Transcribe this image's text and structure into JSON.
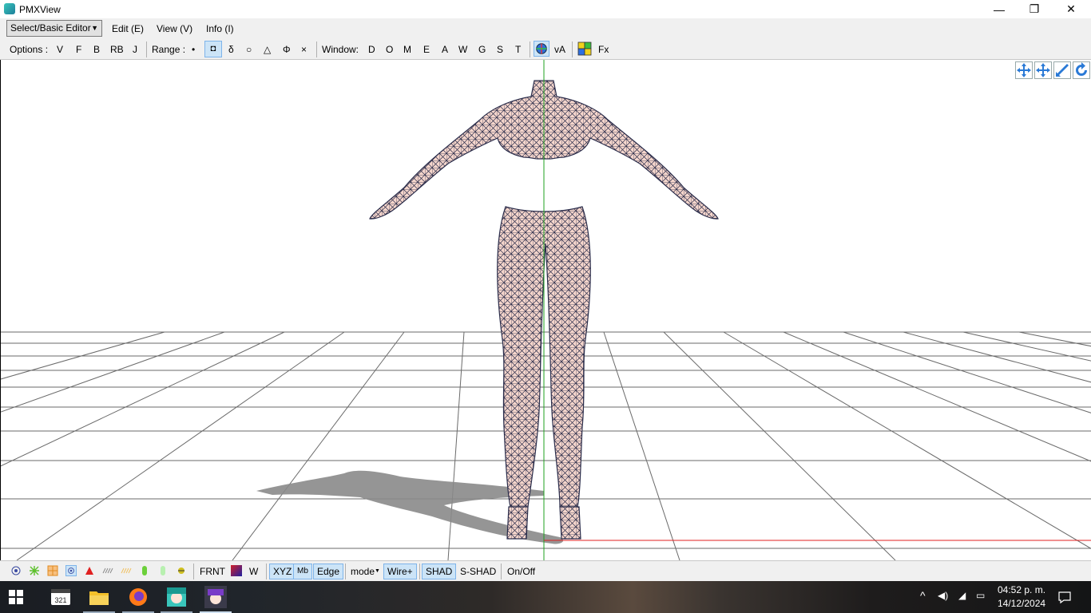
{
  "window": {
    "title": "PMXView",
    "minimize_glyph": "—",
    "maximize_glyph": "❐",
    "close_glyph": "✕"
  },
  "menubar": {
    "mode_select": "Select/Basic Editor",
    "items": [
      "Edit (E)",
      "View (V)",
      "Info (I)"
    ]
  },
  "toolbar": {
    "options_label": "Options :",
    "options": [
      "V",
      "F",
      "B",
      "RB",
      "J"
    ],
    "range_label": "Range :",
    "range_items": [
      "•",
      "◘",
      "δ",
      "○",
      "△",
      "Φ",
      "×"
    ],
    "window_label": "Window:",
    "window_items": [
      "D",
      "O",
      "M",
      "E",
      "A",
      "W",
      "G",
      "S",
      "T"
    ],
    "va_label": "vA",
    "fx_label": "Fx"
  },
  "viewport": {
    "tools": [
      "move-camera-icon",
      "move-axis-icon",
      "zoom-icon",
      "rotate-icon"
    ],
    "colors": {
      "skin": "#f5d6cc",
      "wire": "#2a2c4a",
      "axis_y": "#1fa01f",
      "axis_x": "#e02020",
      "grid": "#6a6a6a",
      "shadow": "#8a8a8a"
    }
  },
  "bottombar": {
    "frnt": "FRNT",
    "w": "W",
    "xyz": "XYZ",
    "mb": "Mb",
    "edge": "Edge",
    "mode": "mode",
    "wire": "Wire+",
    "shad": "SHAD",
    "sshad": "S-SHAD",
    "onoff": "On/Off"
  },
  "taskbar": {
    "time": "04:52 p. m.",
    "date": "14/12/2024",
    "apps": [
      "start-icon",
      "media-player-icon",
      "file-explorer-icon",
      "firefox-icon",
      "miku-app-icon",
      "pmx-app-icon"
    ]
  }
}
